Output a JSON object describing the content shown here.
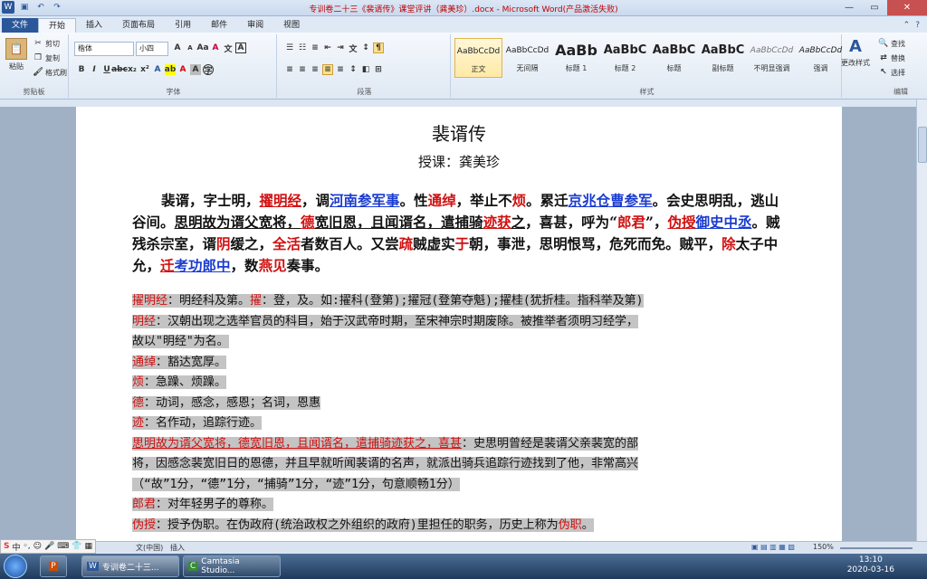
{
  "window": {
    "title": "专训卷二十三《裴谞传》课堂评讲（龚美珍）.docx - Microsoft Word(产品激活失败)"
  },
  "tabs": [
    "文件",
    "开始",
    "插入",
    "页面布局",
    "引用",
    "邮件",
    "审阅",
    "视图"
  ],
  "ribbon": {
    "clipboard": {
      "paste": "粘贴",
      "cut": "剪切",
      "copy": "复制",
      "format_painter": "格式刷",
      "label": "剪贴板"
    },
    "font": {
      "name": "楷体",
      "size": "小四",
      "label": "字体"
    },
    "paragraph": {
      "label": "段落"
    },
    "styles": {
      "label": "样式",
      "items": [
        {
          "sample": "AaBbCcDd",
          "name": "正文"
        },
        {
          "sample": "AaBbCcDd",
          "name": "无间隔"
        },
        {
          "sample": "AaBb",
          "name": "标题 1"
        },
        {
          "sample": "AaBbC",
          "name": "标题 2"
        },
        {
          "sample": "AaBbC",
          "name": "标题"
        },
        {
          "sample": "AaBbC",
          "name": "副标题"
        },
        {
          "sample": "AaBbCcDd",
          "name": "不明显强调"
        },
        {
          "sample": "AaBbCcDd",
          "name": "强调"
        }
      ],
      "change_styles": "更改样式"
    },
    "editing": {
      "find": "查找",
      "replace": "替换",
      "select": "选择",
      "label": "编辑"
    }
  },
  "document": {
    "title": "裴谞传",
    "subtitle": "授课：龚美珍",
    "para": [
      {
        "t": "裴谞，字士明，"
      },
      {
        "t": "擢明经",
        "c": "r",
        "u": 1
      },
      {
        "t": "，调"
      },
      {
        "t": "河南参军事",
        "c": "b",
        "u": 1
      },
      {
        "t": "。性"
      },
      {
        "t": "通绰",
        "c": "r"
      },
      {
        "t": "，举止不"
      },
      {
        "t": "烦",
        "c": "r"
      },
      {
        "t": "。累迁"
      },
      {
        "t": "京兆仓曹参军",
        "c": "b",
        "u": 1
      },
      {
        "t": "。会史思明乱，逃山谷间。"
      },
      {
        "t": "思明故为谞父宽将，",
        "u": 1
      },
      {
        "t": "德",
        "c": "r",
        "u": 1
      },
      {
        "t": "宽旧恩，且闻谞名，遣捕骑",
        "u": 1
      },
      {
        "t": "迹获",
        "c": "r",
        "u": 1
      },
      {
        "t": "之",
        "u": 1
      },
      {
        "t": "，喜甚，呼为“"
      },
      {
        "t": "郎君",
        "c": "r"
      },
      {
        "t": "”，"
      },
      {
        "t": "伪授",
        "c": "r",
        "u": 1
      },
      {
        "t": "御史中丞",
        "c": "b",
        "u": 1
      },
      {
        "t": "。贼残杀宗室，谞"
      },
      {
        "t": "阴",
        "c": "r"
      },
      {
        "t": "缓之，"
      },
      {
        "t": "全活",
        "c": "r"
      },
      {
        "t": "者数百人。又尝"
      },
      {
        "t": "疏",
        "c": "r"
      },
      {
        "t": "贼虚实"
      },
      {
        "t": "于",
        "c": "r"
      },
      {
        "t": "朝，事泄，思明恨骂，危死而免。贼平，"
      },
      {
        "t": "除",
        "c": "r"
      },
      {
        "t": "太子中允，"
      },
      {
        "t": "迁",
        "c": "r",
        "u": 1
      },
      {
        "t": "考功郎中",
        "c": "b",
        "u": 1
      },
      {
        "t": "，数"
      },
      {
        "t": "燕见",
        "c": "r"
      },
      {
        "t": "奏事。"
      }
    ],
    "notes": [
      [
        {
          "t": "擢明经",
          "c": "r"
        },
        {
          "t": "：明经科及第。"
        },
        {
          "t": "擢",
          "c": "r"
        },
        {
          "t": "：登，及。如:擢科(登第);擢冠(登第夺魁);擢桂(犹折桂。指科举及第)"
        }
      ],
      [
        {
          "t": "明经",
          "c": "r"
        },
        {
          "t": "：汉朝出现之选举官员的科目，始于汉武帝时期，至宋神宗时期废除。被推举者须明习经学，"
        }
      ],
      [
        {
          "t": "故以\"明经\"为名。"
        }
      ],
      [
        {
          "t": "通绰",
          "c": "r"
        },
        {
          "t": "：豁达宽厚。"
        }
      ],
      [
        {
          "t": "烦",
          "c": "r"
        },
        {
          "t": "：急躁、烦躁。"
        }
      ],
      [
        {
          "t": "德",
          "c": "r"
        },
        {
          "t": "：动词，感念，感恩；名词，恩惠"
        }
      ],
      [
        {
          "t": "迹",
          "c": "r"
        },
        {
          "t": "：名作动，追踪行迹。"
        }
      ],
      [
        {
          "t": "思明故为谞父宽将，德宽旧恩，且闻谞名，遣捕骑迹获之，喜甚",
          "c": "r",
          "u": 1
        },
        {
          "t": "：史思明曾经是裴谞父亲裴宽的部"
        }
      ],
      [
        {
          "t": "将，因感念裴宽旧日的恩德，并且早就听闻裴谞的名声，就派出骑兵追踪行迹找到了他，非常高兴"
        }
      ],
      [
        {
          "t": "（“故”1分，“德”1分，“捕骑”1分，“迹”1分，句意顺畅1分）"
        }
      ],
      [
        {
          "t": "郎君",
          "c": "r"
        },
        {
          "t": "：对年轻男子的尊称。"
        }
      ],
      [
        {
          "t": "伪授",
          "c": "r"
        },
        {
          "t": "：授予伪职。在伪政府(统治政权之外组织的政府)里担任的职务，历史上称为"
        },
        {
          "t": "伪职",
          "c": "r"
        },
        {
          "t": "。"
        }
      ]
    ]
  },
  "status": {
    "language": "文(中国)",
    "mode": "插入",
    "zoom": "150%"
  },
  "taskbar": {
    "items": [
      "专训卷二十三...",
      "Camtasia Studio..."
    ],
    "time": "13:10",
    "date": "2020-03-16"
  },
  "ime": {
    "lang": "中"
  },
  "colors": {
    "red": "#d01010",
    "blue": "#1a3bd0",
    "highlight": "#c4c4c4"
  }
}
